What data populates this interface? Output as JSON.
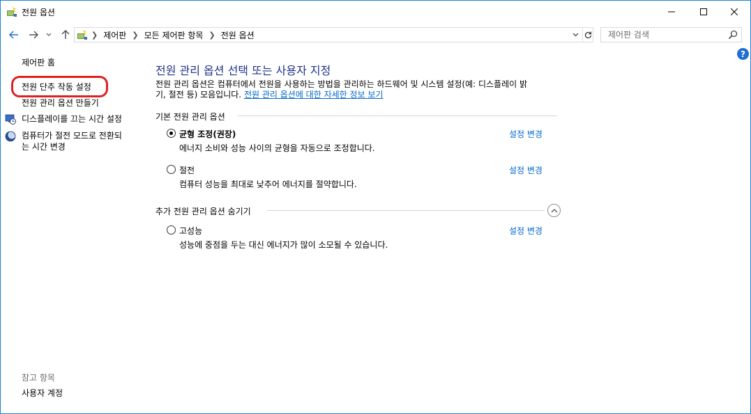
{
  "window": {
    "title": "전원 옵션"
  },
  "address": {
    "crumbs": [
      "제어판",
      "모든 제어판 항목",
      "전원 옵션"
    ],
    "search_placeholder": "제어판 검색"
  },
  "help": {
    "label": "?"
  },
  "sidebar": {
    "home": "제어판 홈",
    "items": [
      {
        "label": "전원 단추 작동 설정"
      },
      {
        "label": "전원 관리 옵션 만들기"
      },
      {
        "label": "디스플레이를 끄는 시간 설정",
        "icon": "display-clock-icon"
      },
      {
        "label_line1": "컴퓨터가 절전 모드로 전환되",
        "label_line2": "는 시간 변경",
        "icon": "sleep-moon-icon"
      }
    ],
    "see_also_title": "참고 항목",
    "see_also_items": [
      "사용자 계정"
    ]
  },
  "main": {
    "title": "전원 관리 옵션 선택 또는 사용자 지정",
    "desc_line1": "전원 관리 옵션은 컴퓨터에서 전원을 사용하는 방법을 관리하는 하드웨어 및 시스템 설정(예: 디스플레이 밝",
    "desc_line2": "기, 절전 등) 모음입니다.",
    "desc_link": "전원 관리 옵션에 대한 자세한 정보 보기",
    "basic_header": "기본 전원 관리 옵션",
    "extra_header": "추가 전원 관리 옵션 숨기기",
    "plans": [
      {
        "name": "균형 조정(권장)",
        "desc": "에너지 소비와 성능 사이의 균형을 자동으로 조정합니다.",
        "change": "설정 변경",
        "selected": true
      },
      {
        "name": "절전",
        "desc": "컴퓨터 성능을 최대로 낮추어 에너지를 절약합니다.",
        "change": "설정 변경",
        "selected": false
      },
      {
        "name": "고성능",
        "desc": "성능에 중점을 두는 대신 에너지가 많이 소모될 수 있습니다.",
        "change": "설정 변경",
        "selected": false
      }
    ]
  },
  "colors": {
    "title_blue": "#1e3287",
    "link_blue": "#0066cc",
    "highlight_red": "#e02020",
    "window_border": "#1883d7"
  }
}
